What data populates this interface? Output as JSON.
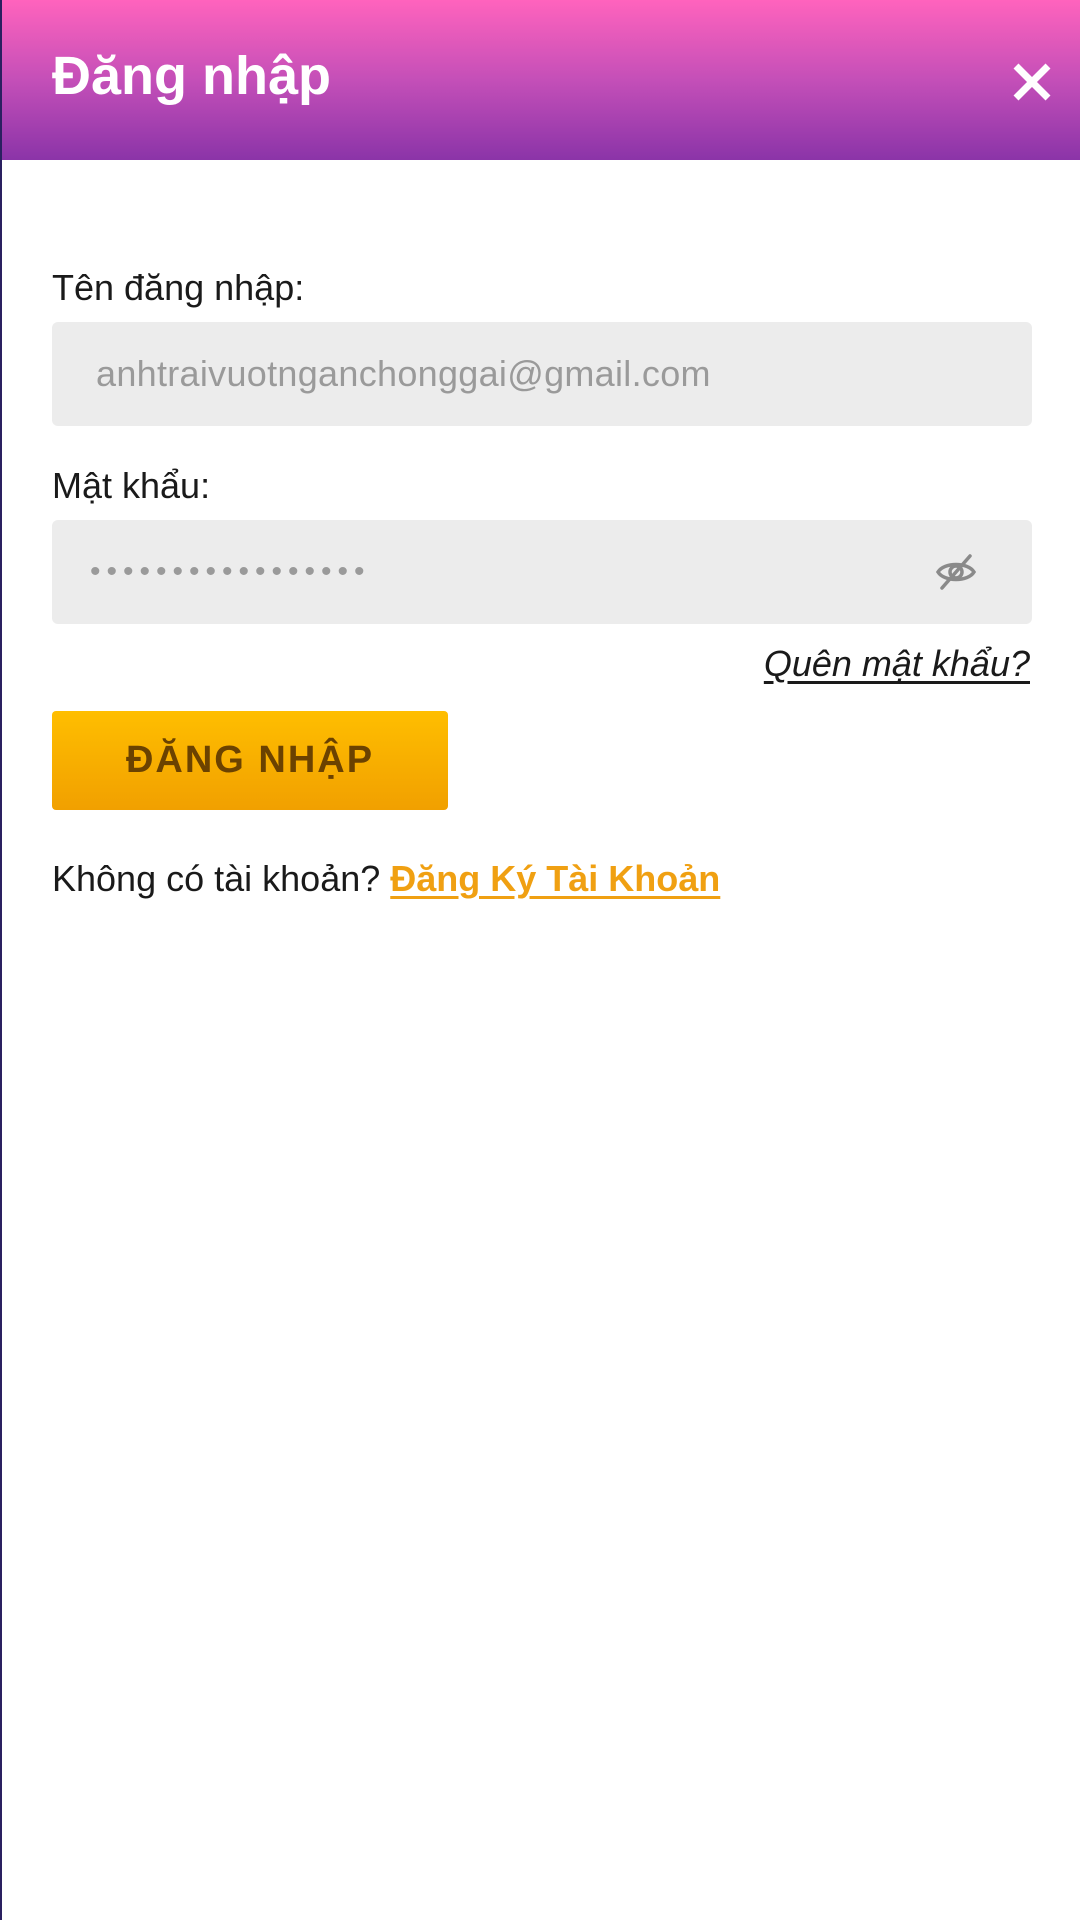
{
  "header": {
    "title": "Đăng nhập",
    "close_icon": "close-icon",
    "gradient_colors": [
      "#ff63bd",
      "#8b34a8"
    ]
  },
  "form": {
    "username": {
      "label": "Tên đăng nhập:",
      "value": "anhtraivuotnganchonggai@gmail.com"
    },
    "password": {
      "label": "Mật khẩu:",
      "masked_value": "•••••••••••••••••",
      "toggle_icon": "eye-off-icon"
    },
    "forgot_password": "Quên mật khẩu?",
    "submit_label": "ĐĂNG NHẬP",
    "submit_color": "#ffbe00"
  },
  "register": {
    "prompt": "Không có tài khoản? ",
    "link": "Đăng Ký Tài Khoản",
    "link_color": "#f0a012"
  }
}
